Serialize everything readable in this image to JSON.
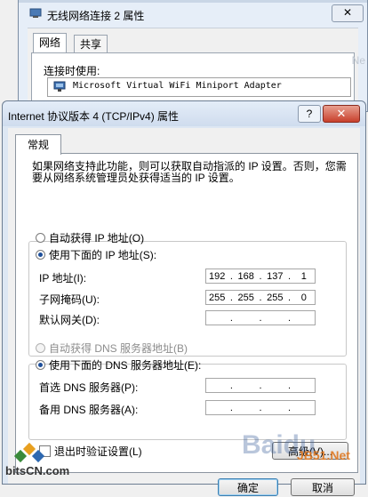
{
  "background_window": {
    "title": "无线网络连接 2 属性",
    "tabs": [
      {
        "label": "网络"
      },
      {
        "label": "共享"
      }
    ],
    "connect_using_label": "连接时使用:",
    "adapter_name": "Microsoft Virtual WiFi Miniport Adapter",
    "watermark_text": "Ne",
    "close_glyph": "✕"
  },
  "dialog": {
    "title": "Internet 协议版本 4 (TCP/IPv4) 属性",
    "help_glyph": "?",
    "close_glyph": "✕",
    "tab_label": "常规",
    "description": "如果网络支持此功能，则可以获取自动指派的 IP 设置。否则，您需要从网络系统管理员处获得适当的 IP 设置。",
    "ip_auto_label": "自动获得 IP 地址(O)",
    "ip_manual_label": "使用下面的 IP 地址(S):",
    "ip_address_label": "IP 地址(I):",
    "subnet_label": "子网掩码(U):",
    "gateway_label": "默认网关(D):",
    "ip_address": [
      "192",
      "168",
      "137",
      "1"
    ],
    "subnet_mask": [
      "255",
      "255",
      "255",
      "0"
    ],
    "gateway": [
      "",
      "",
      "",
      ""
    ],
    "dns_auto_label": "自动获得 DNS 服务器地址(B)",
    "dns_manual_label": "使用下面的 DNS 服务器地址(E):",
    "preferred_dns_label": "首选 DNS 服务器(P):",
    "alternate_dns_label": "备用 DNS 服务器(A):",
    "preferred_dns": [
      "",
      "",
      "",
      ""
    ],
    "alternate_dns": [
      "",
      "",
      "",
      ""
    ],
    "validate_label": "退出时验证设置(L)",
    "advanced_label": "高级(V)...",
    "ok_label": "确定",
    "cancel_label": "取消"
  },
  "watermarks": {
    "bitscn": "bitsCN.com",
    "baidu": "Baidu",
    "jb51": "JB51.Net"
  }
}
